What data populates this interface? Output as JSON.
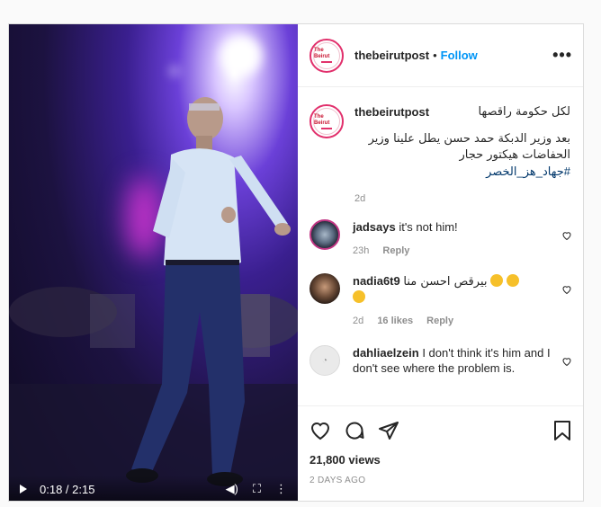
{
  "post": {
    "username": "thebeirutpost",
    "separator": "•",
    "follow_label": "Follow",
    "more_label": "•••",
    "avatar_brand": [
      "The Beirut",
      "POST"
    ]
  },
  "caption": {
    "username": "thebeirutpost",
    "line1": "لكل حكومة راقصها",
    "line2": "بعد وزير الدبكة حمد حسن يطل علينا وزير الحفاضات هيكتور حجار",
    "hashtag": "#جهاد_هز_الخصر",
    "time": "2d"
  },
  "comments": [
    {
      "username": "jadsays",
      "text": "it's not him!",
      "time": "23h",
      "likes": "",
      "reply": "Reply"
    },
    {
      "username": "nadia6t9",
      "text": "بيرقص احسن منا",
      "time": "2d",
      "likes": "16 likes",
      "reply": "Reply"
    },
    {
      "username": "dahliaelzein",
      "text": "I don't think it's him and I don't see where the problem is.",
      "time": "",
      "likes": "",
      "reply": ""
    }
  ],
  "stats": {
    "views": "21,800 views",
    "date": "2 DAYS AGO"
  },
  "video": {
    "time_display": "0:18 / 2:15"
  },
  "colors": {
    "follow": "#0095f6",
    "hashtag": "#00376b",
    "muted": "#8e8e8e",
    "avatar_ring": "#e1306c",
    "emoji": "#f6c02a"
  },
  "icons": [
    "play-icon",
    "volume-icon",
    "fullscreen-icon",
    "video-more-icon",
    "heart-icon",
    "comment-icon",
    "share-icon",
    "bookmark-icon",
    "heart-small-icon",
    "more-options-icon"
  ]
}
